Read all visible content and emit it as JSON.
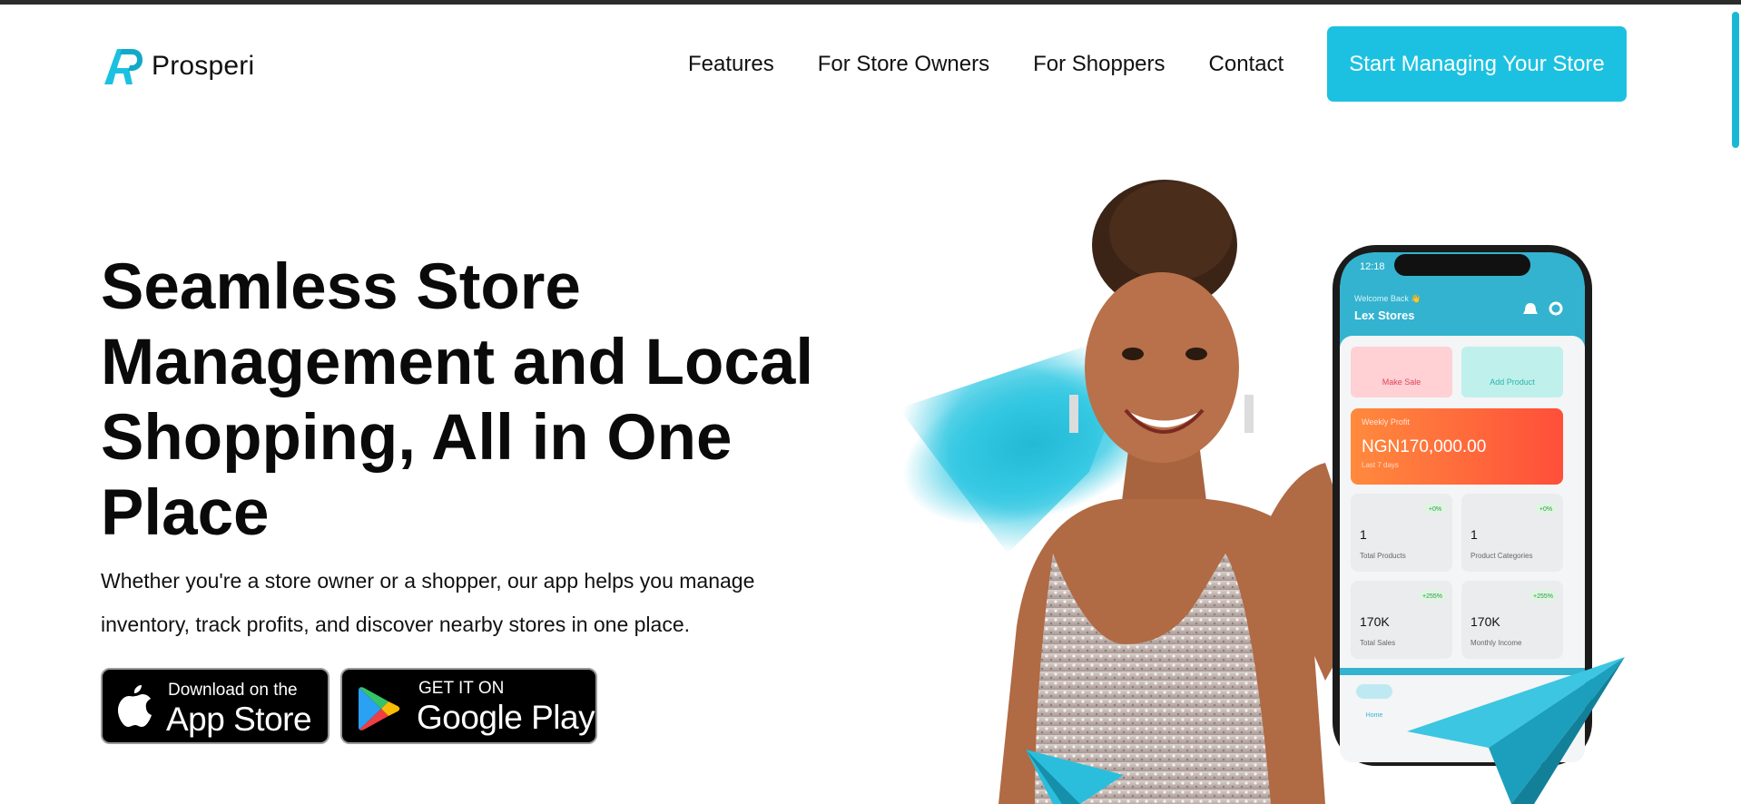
{
  "brand": {
    "name": "Prosperi"
  },
  "nav": {
    "items": [
      {
        "label": "Features"
      },
      {
        "label": "For Store Owners"
      },
      {
        "label": "For Shoppers"
      },
      {
        "label": "Contact"
      }
    ],
    "cta_label": "Start Managing Your Store"
  },
  "hero": {
    "title": "Seamless Store Management and Local Shopping, All in One Place",
    "subtitle": "Whether you're a store owner or a shopper, our app helps you manage inventory, track profits, and discover nearby stores in one place.",
    "app_store": {
      "small": "Download on the",
      "big": "App Store"
    },
    "google_play": {
      "small": "GET IT ON",
      "big": "Google Play"
    }
  },
  "phone": {
    "time": "12:18",
    "welcome": "Welcome Back 👋",
    "store_name": "Lex Stores",
    "make_sale": "Make Sale",
    "add_product": "Add Product",
    "profit_label": "Weekly Profit",
    "profit_value": "NGN170,000.00",
    "profit_period": "Last 7 days",
    "stats": [
      {
        "badge": "+0%",
        "value": "1",
        "label": "Total Products"
      },
      {
        "badge": "+0%",
        "value": "1",
        "label": "Product Categories"
      },
      {
        "badge": "+255%",
        "value": "170K",
        "label": "Total Sales"
      },
      {
        "badge": "+255%",
        "value": "170K",
        "label": "Monthly Income"
      }
    ],
    "tab_home": "Home"
  },
  "colors": {
    "accent": "#1cc1e1",
    "profit_gradient_start": "#ff8a3d",
    "profit_gradient_end": "#ff4f3a",
    "make_sale_bg": "#ffd0d4",
    "add_product_bg": "#bff0ec"
  },
  "icons": {
    "logo": "prosperi-logo-icon",
    "apple": "apple-icon",
    "google_play": "google-play-icon",
    "bell": "bell-icon",
    "gear": "gear-icon"
  }
}
